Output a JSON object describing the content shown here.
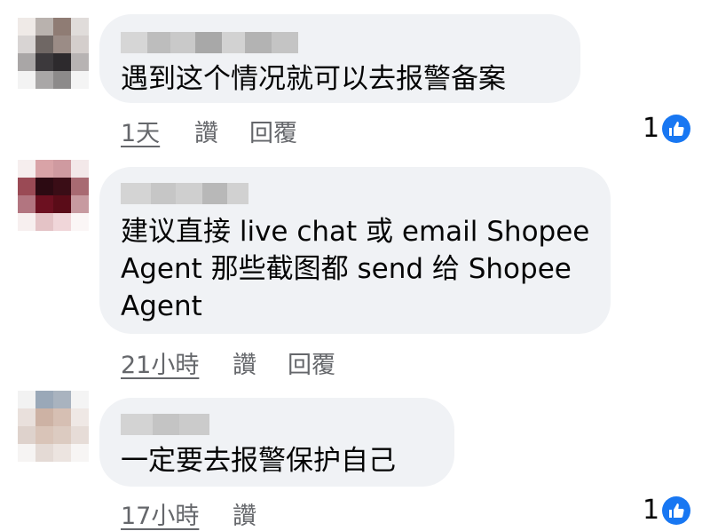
{
  "comments": [
    {
      "text_lines": [
        "遇到这个情况就可以去报警备案"
      ],
      "time": "1天",
      "like_label": "讚",
      "reply_label": "回覆",
      "reaction_count": "1"
    },
    {
      "text_lines": [
        "建议直接 live chat 或 email Shopee",
        "Agent 那些截图都 send 给 Shopee",
        "Agent"
      ],
      "time": "21小時",
      "like_label": "讚",
      "reply_label": "回覆"
    },
    {
      "text_lines": [
        "一定要去报警保护自己"
      ],
      "time": "17小時",
      "like_label": "讚",
      "reaction_count": "1"
    }
  ],
  "colors": {
    "bubble": "#f0f2f5",
    "meta_text": "#65676b",
    "like_blue": "#1877f2"
  },
  "icons": {
    "reaction": "thumbs-up-icon"
  }
}
